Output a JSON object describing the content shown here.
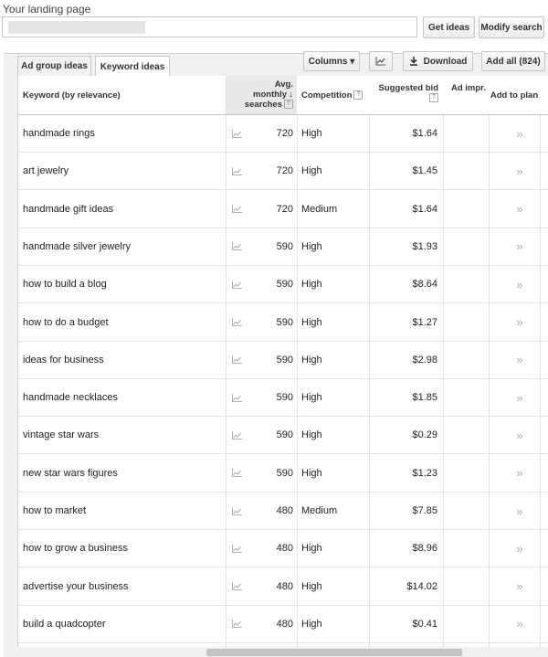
{
  "header": {
    "landing_label": "Your landing page",
    "url_value": "",
    "get_ideas": "Get ideas",
    "modify_search": "Modify search"
  },
  "tabs": {
    "ad_group": "Ad group ideas",
    "keyword": "Keyword ideas"
  },
  "toolbar": {
    "columns": "Columns ▾",
    "download": "Download",
    "add_all": "Add all (824)"
  },
  "table": {
    "headers": {
      "keyword": "Keyword (by relevance)",
      "avg_1": "Avg.",
      "avg_2": "monthly",
      "avg_3": "searches",
      "competition": "Competition",
      "bid": "Suggested bid",
      "impr": "Ad impr.",
      "plan": "Add to plan"
    },
    "rows": [
      {
        "keyword": "handmade rings",
        "avg": "720",
        "competition": "High",
        "bid": "$1.64"
      },
      {
        "keyword": "art jewelry",
        "avg": "720",
        "competition": "High",
        "bid": "$1.45"
      },
      {
        "keyword": "handmade gift ideas",
        "avg": "720",
        "competition": "Medium",
        "bid": "$1.64"
      },
      {
        "keyword": "handmade silver jewelry",
        "avg": "590",
        "competition": "High",
        "bid": "$1.93"
      },
      {
        "keyword": "how to build a blog",
        "avg": "590",
        "competition": "High",
        "bid": "$8.64"
      },
      {
        "keyword": "how to do a budget",
        "avg": "590",
        "competition": "High",
        "bid": "$1.27"
      },
      {
        "keyword": "ideas for business",
        "avg": "590",
        "competition": "High",
        "bid": "$2.98"
      },
      {
        "keyword": "handmade necklaces",
        "avg": "590",
        "competition": "High",
        "bid": "$1.85"
      },
      {
        "keyword": "vintage star wars",
        "avg": "590",
        "competition": "High",
        "bid": "$0.29"
      },
      {
        "keyword": "new star wars figures",
        "avg": "590",
        "competition": "High",
        "bid": "$1.23"
      },
      {
        "keyword": "how to market",
        "avg": "480",
        "competition": "Medium",
        "bid": "$7.85"
      },
      {
        "keyword": "how to grow a business",
        "avg": "480",
        "competition": "High",
        "bid": "$8.96"
      },
      {
        "keyword": "advertise your business",
        "avg": "480",
        "competition": "High",
        "bid": "$14.02"
      },
      {
        "keyword": "build a quadcopter",
        "avg": "480",
        "competition": "High",
        "bid": "$0.41"
      }
    ]
  },
  "icons": {
    "trend": "trend-chart-icon",
    "add": "double-chevron-right-icon",
    "download": "download-icon",
    "chart": "chart-icon",
    "help": "question-icon"
  }
}
